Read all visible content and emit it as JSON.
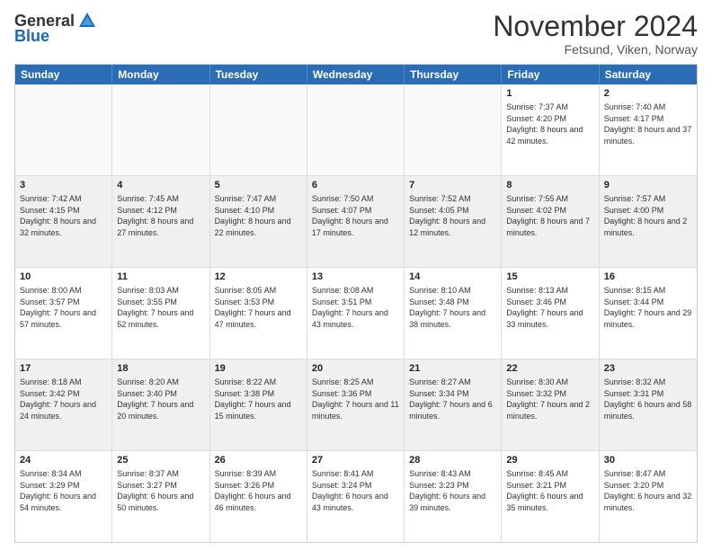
{
  "logo": {
    "general": "General",
    "blue": "Blue"
  },
  "header": {
    "month_year": "November 2024",
    "location": "Fetsund, Viken, Norway"
  },
  "days_of_week": [
    "Sunday",
    "Monday",
    "Tuesday",
    "Wednesday",
    "Thursday",
    "Friday",
    "Saturday"
  ],
  "rows": [
    [
      {
        "day": "",
        "empty": true
      },
      {
        "day": "",
        "empty": true
      },
      {
        "day": "",
        "empty": true
      },
      {
        "day": "",
        "empty": true
      },
      {
        "day": "",
        "empty": true
      },
      {
        "day": "1",
        "sunrise": "Sunrise: 7:37 AM",
        "sunset": "Sunset: 4:20 PM",
        "daylight": "Daylight: 8 hours and 42 minutes."
      },
      {
        "day": "2",
        "sunrise": "Sunrise: 7:40 AM",
        "sunset": "Sunset: 4:17 PM",
        "daylight": "Daylight: 8 hours and 37 minutes."
      }
    ],
    [
      {
        "day": "3",
        "sunrise": "Sunrise: 7:42 AM",
        "sunset": "Sunset: 4:15 PM",
        "daylight": "Daylight: 8 hours and 32 minutes."
      },
      {
        "day": "4",
        "sunrise": "Sunrise: 7:45 AM",
        "sunset": "Sunset: 4:12 PM",
        "daylight": "Daylight: 8 hours and 27 minutes."
      },
      {
        "day": "5",
        "sunrise": "Sunrise: 7:47 AM",
        "sunset": "Sunset: 4:10 PM",
        "daylight": "Daylight: 8 hours and 22 minutes."
      },
      {
        "day": "6",
        "sunrise": "Sunrise: 7:50 AM",
        "sunset": "Sunset: 4:07 PM",
        "daylight": "Daylight: 8 hours and 17 minutes."
      },
      {
        "day": "7",
        "sunrise": "Sunrise: 7:52 AM",
        "sunset": "Sunset: 4:05 PM",
        "daylight": "Daylight: 8 hours and 12 minutes."
      },
      {
        "day": "8",
        "sunrise": "Sunrise: 7:55 AM",
        "sunset": "Sunset: 4:02 PM",
        "daylight": "Daylight: 8 hours and 7 minutes."
      },
      {
        "day": "9",
        "sunrise": "Sunrise: 7:57 AM",
        "sunset": "Sunset: 4:00 PM",
        "daylight": "Daylight: 8 hours and 2 minutes."
      }
    ],
    [
      {
        "day": "10",
        "sunrise": "Sunrise: 8:00 AM",
        "sunset": "Sunset: 3:57 PM",
        "daylight": "Daylight: 7 hours and 57 minutes."
      },
      {
        "day": "11",
        "sunrise": "Sunrise: 8:03 AM",
        "sunset": "Sunset: 3:55 PM",
        "daylight": "Daylight: 7 hours and 52 minutes."
      },
      {
        "day": "12",
        "sunrise": "Sunrise: 8:05 AM",
        "sunset": "Sunset: 3:53 PM",
        "daylight": "Daylight: 7 hours and 47 minutes."
      },
      {
        "day": "13",
        "sunrise": "Sunrise: 8:08 AM",
        "sunset": "Sunset: 3:51 PM",
        "daylight": "Daylight: 7 hours and 43 minutes."
      },
      {
        "day": "14",
        "sunrise": "Sunrise: 8:10 AM",
        "sunset": "Sunset: 3:48 PM",
        "daylight": "Daylight: 7 hours and 38 minutes."
      },
      {
        "day": "15",
        "sunrise": "Sunrise: 8:13 AM",
        "sunset": "Sunset: 3:46 PM",
        "daylight": "Daylight: 7 hours and 33 minutes."
      },
      {
        "day": "16",
        "sunrise": "Sunrise: 8:15 AM",
        "sunset": "Sunset: 3:44 PM",
        "daylight": "Daylight: 7 hours and 29 minutes."
      }
    ],
    [
      {
        "day": "17",
        "sunrise": "Sunrise: 8:18 AM",
        "sunset": "Sunset: 3:42 PM",
        "daylight": "Daylight: 7 hours and 24 minutes."
      },
      {
        "day": "18",
        "sunrise": "Sunrise: 8:20 AM",
        "sunset": "Sunset: 3:40 PM",
        "daylight": "Daylight: 7 hours and 20 minutes."
      },
      {
        "day": "19",
        "sunrise": "Sunrise: 8:22 AM",
        "sunset": "Sunset: 3:38 PM",
        "daylight": "Daylight: 7 hours and 15 minutes."
      },
      {
        "day": "20",
        "sunrise": "Sunrise: 8:25 AM",
        "sunset": "Sunset: 3:36 PM",
        "daylight": "Daylight: 7 hours and 11 minutes."
      },
      {
        "day": "21",
        "sunrise": "Sunrise: 8:27 AM",
        "sunset": "Sunset: 3:34 PM",
        "daylight": "Daylight: 7 hours and 6 minutes."
      },
      {
        "day": "22",
        "sunrise": "Sunrise: 8:30 AM",
        "sunset": "Sunset: 3:32 PM",
        "daylight": "Daylight: 7 hours and 2 minutes."
      },
      {
        "day": "23",
        "sunrise": "Sunrise: 8:32 AM",
        "sunset": "Sunset: 3:31 PM",
        "daylight": "Daylight: 6 hours and 58 minutes."
      }
    ],
    [
      {
        "day": "24",
        "sunrise": "Sunrise: 8:34 AM",
        "sunset": "Sunset: 3:29 PM",
        "daylight": "Daylight: 6 hours and 54 minutes."
      },
      {
        "day": "25",
        "sunrise": "Sunrise: 8:37 AM",
        "sunset": "Sunset: 3:27 PM",
        "daylight": "Daylight: 6 hours and 50 minutes."
      },
      {
        "day": "26",
        "sunrise": "Sunrise: 8:39 AM",
        "sunset": "Sunset: 3:26 PM",
        "daylight": "Daylight: 6 hours and 46 minutes."
      },
      {
        "day": "27",
        "sunrise": "Sunrise: 8:41 AM",
        "sunset": "Sunset: 3:24 PM",
        "daylight": "Daylight: 6 hours and 43 minutes."
      },
      {
        "day": "28",
        "sunrise": "Sunrise: 8:43 AM",
        "sunset": "Sunset: 3:23 PM",
        "daylight": "Daylight: 6 hours and 39 minutes."
      },
      {
        "day": "29",
        "sunrise": "Sunrise: 8:45 AM",
        "sunset": "Sunset: 3:21 PM",
        "daylight": "Daylight: 6 hours and 35 minutes."
      },
      {
        "day": "30",
        "sunrise": "Sunrise: 8:47 AM",
        "sunset": "Sunset: 3:20 PM",
        "daylight": "Daylight: 6 hours and 32 minutes."
      }
    ]
  ]
}
